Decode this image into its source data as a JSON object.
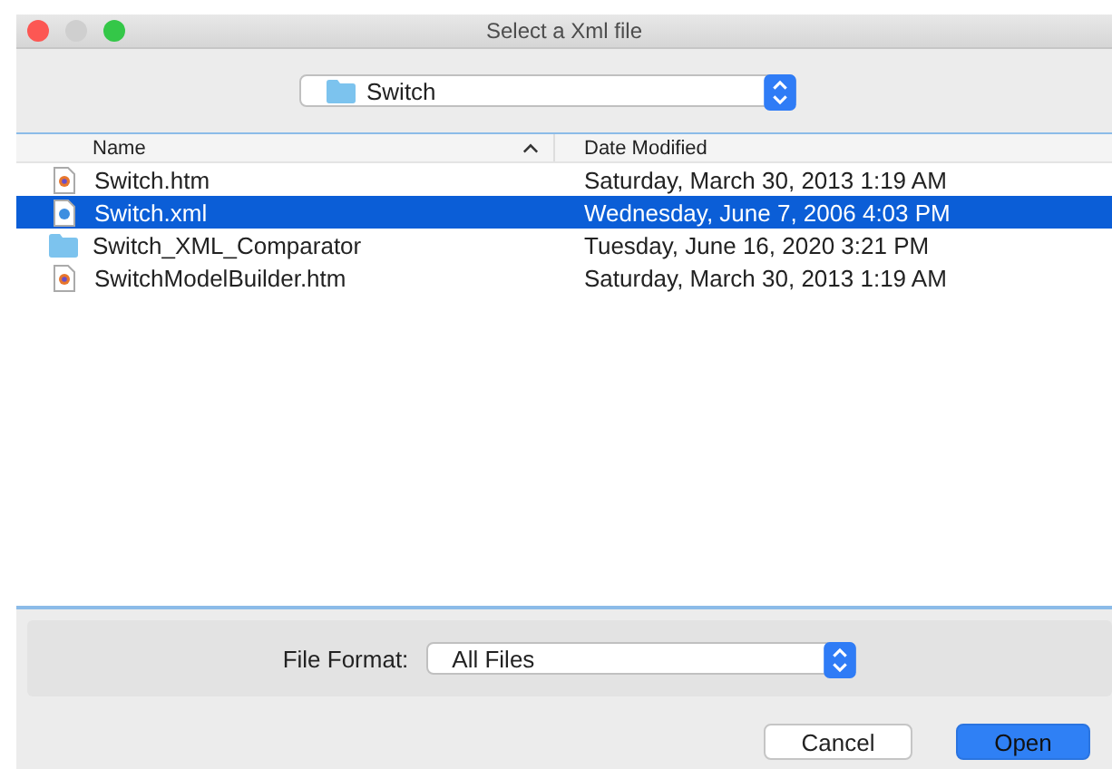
{
  "window": {
    "title": "Select a Xml file"
  },
  "location": {
    "value": "Switch"
  },
  "table": {
    "columns": [
      {
        "label": "Name",
        "sorted": true
      },
      {
        "label": "Date Modified",
        "sorted": false
      }
    ],
    "rows": [
      {
        "kind": "web",
        "name": "Switch.htm",
        "date": "Saturday, March 30, 2013 1:19 AM",
        "selected": false
      },
      {
        "kind": "xml",
        "name": "Switch.xml",
        "date": "Wednesday, June 7, 2006 4:03 PM",
        "selected": true
      },
      {
        "kind": "folder",
        "name": "Switch_XML_Comparator",
        "date": "Tuesday, June 16, 2020 3:21 PM",
        "selected": false
      },
      {
        "kind": "web",
        "name": "SwitchModelBuilder.htm",
        "date": "Saturday, March 30, 2013 1:19 AM",
        "selected": false
      }
    ]
  },
  "file_format": {
    "label": "File Format:",
    "value": "All Files"
  },
  "buttons": [
    {
      "label": "Cancel",
      "kind": "secondary"
    },
    {
      "label": "Open",
      "kind": "primary"
    }
  ]
}
